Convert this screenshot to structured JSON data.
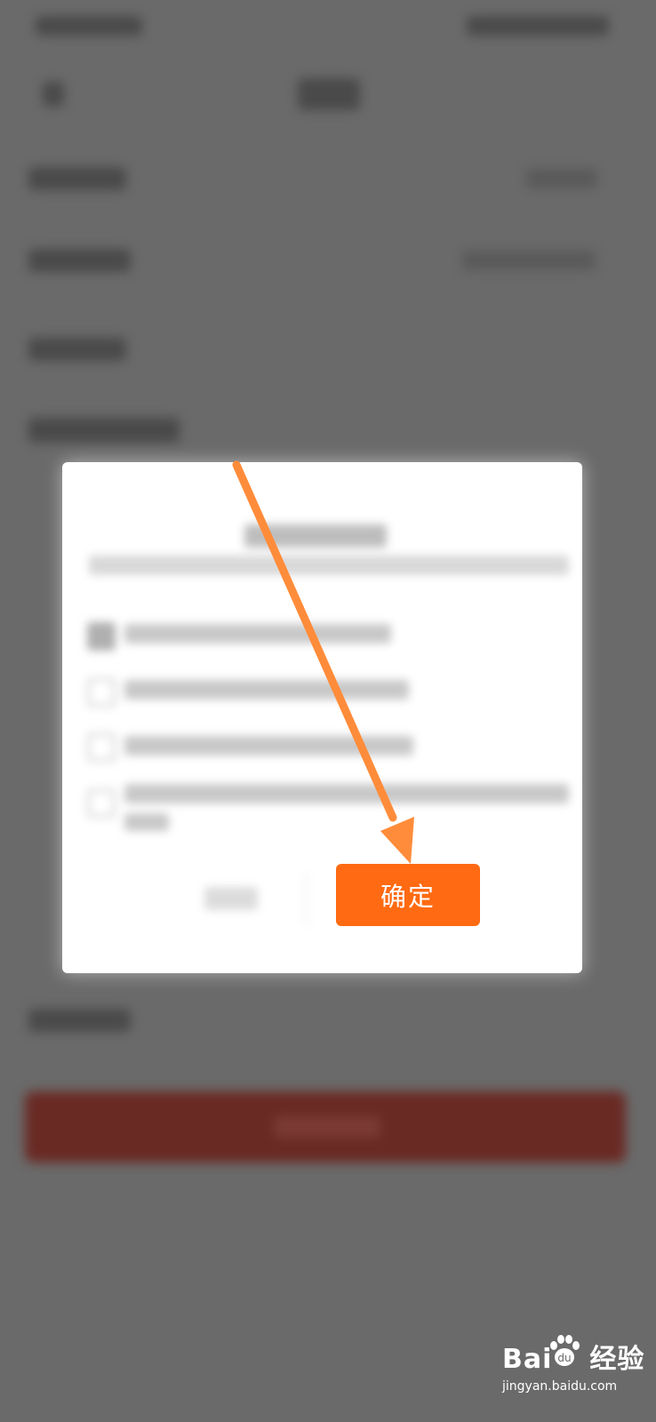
{
  "dialog": {
    "confirm_label": "确定"
  },
  "watermark": {
    "brand_left": "Bai",
    "brand_right": "经验",
    "url": "jingyan.baidu.com"
  },
  "colors": {
    "confirm_button": "#ff6a12",
    "arrow": "#ff8c3a",
    "overlay": "#6a6a6a",
    "background_cta": "#6a2a24"
  },
  "icons": {
    "arrow": "arrow-annotation-icon",
    "paw": "baidu-paw-icon"
  }
}
